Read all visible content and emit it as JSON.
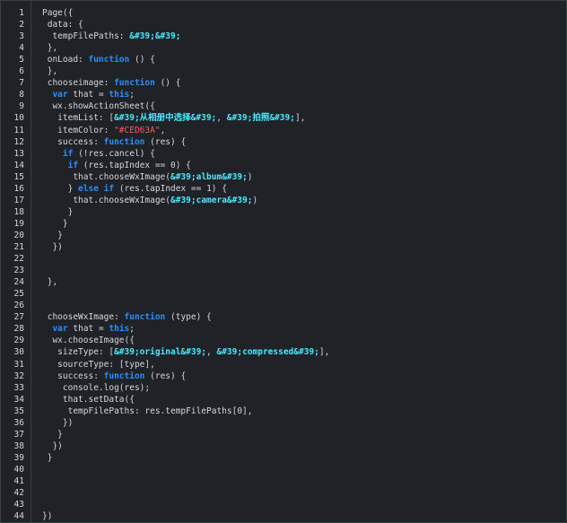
{
  "editor": {
    "lines": [
      {
        "num": "1",
        "code": "Page({"
      },
      {
        "num": "2",
        "code": " data: {"
      },
      {
        "num": "3",
        "code": "  tempFilePaths: &#39;&#39;"
      },
      {
        "num": "4",
        "code": " },"
      },
      {
        "num": "5",
        "code": " onLoad: function () {"
      },
      {
        "num": "6",
        "code": " },"
      },
      {
        "num": "7",
        "code": " chooseimage: function () {"
      },
      {
        "num": "8",
        "code": "  var that = this;"
      },
      {
        "num": "9",
        "code": "  wx.showActionSheet({"
      },
      {
        "num": "10",
        "code": "   itemList: [&#39;从相册中选择&#39;, &#39;拍照&#39;],"
      },
      {
        "num": "11",
        "code": "   itemColor: \"#CED63A\","
      },
      {
        "num": "12",
        "code": "   success: function (res) {"
      },
      {
        "num": "13",
        "code": "    if (!res.cancel) {"
      },
      {
        "num": "14",
        "code": "     if (res.tapIndex == 0) {"
      },
      {
        "num": "15",
        "code": "      that.chooseWxImage(&#39;album&#39;)"
      },
      {
        "num": "16",
        "code": "     } else if (res.tapIndex == 1) {"
      },
      {
        "num": "17",
        "code": "      that.chooseWxImage(&#39;camera&#39;)"
      },
      {
        "num": "18",
        "code": "     }"
      },
      {
        "num": "19",
        "code": "    }"
      },
      {
        "num": "20",
        "code": "   }"
      },
      {
        "num": "21",
        "code": "  })"
      },
      {
        "num": "22",
        "code": ""
      },
      {
        "num": "23",
        "code": ""
      },
      {
        "num": "24",
        "code": " },"
      },
      {
        "num": "25",
        "code": ""
      },
      {
        "num": "26",
        "code": ""
      },
      {
        "num": "27",
        "code": " chooseWxImage: function (type) {"
      },
      {
        "num": "28",
        "code": "  var that = this;"
      },
      {
        "num": "29",
        "code": "  wx.chooseImage({"
      },
      {
        "num": "30",
        "code": "   sizeType: [&#39;original&#39;, &#39;compressed&#39;],"
      },
      {
        "num": "31",
        "code": "   sourceType: [type],"
      },
      {
        "num": "32",
        "code": "   success: function (res) {"
      },
      {
        "num": "33",
        "code": "    console.log(res);"
      },
      {
        "num": "34",
        "code": "    that.setData({"
      },
      {
        "num": "35",
        "code": "     tempFilePaths: res.tempFilePaths[0],"
      },
      {
        "num": "36",
        "code": "    })"
      },
      {
        "num": "37",
        "code": "   }"
      },
      {
        "num": "38",
        "code": "  })"
      },
      {
        "num": "39",
        "code": " }"
      },
      {
        "num": "40",
        "code": ""
      },
      {
        "num": "41",
        "code": ""
      },
      {
        "num": "42",
        "code": ""
      },
      {
        "num": "43",
        "code": ""
      },
      {
        "num": "44",
        "code": "})"
      }
    ],
    "colors": {
      "background": "#1f2328",
      "text": "#d6d6d6",
      "keyword": "#2c8cff",
      "string": "#4de9ff",
      "color_literal": "#ff5a5a"
    }
  }
}
